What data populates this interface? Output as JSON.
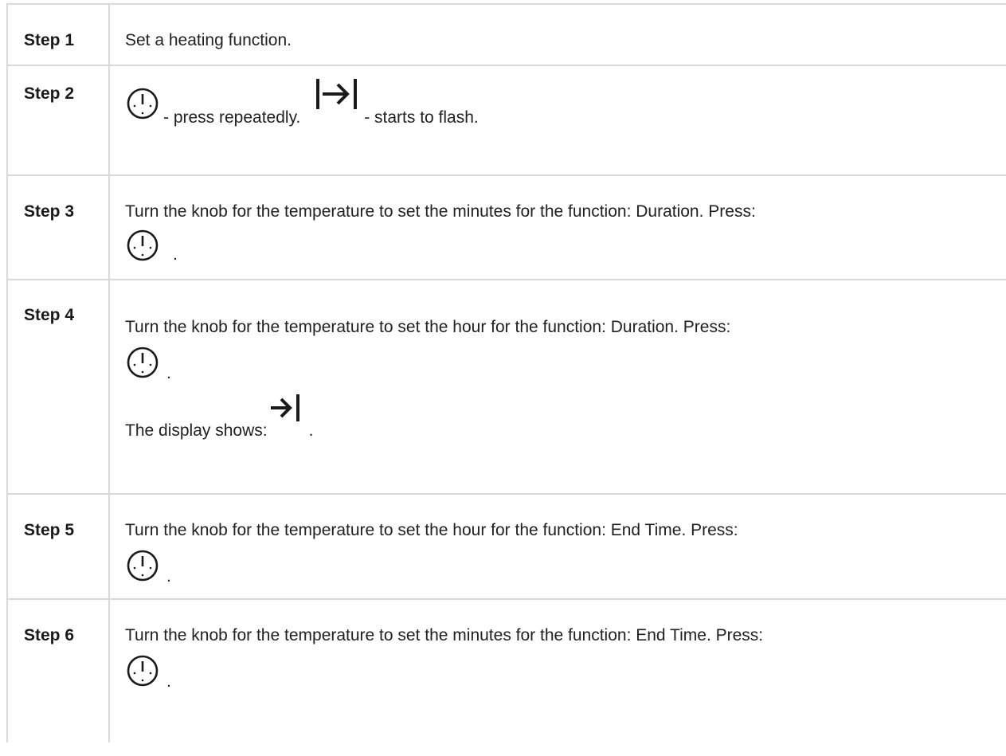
{
  "steps": [
    {
      "label": "Step 1",
      "text": "Set a heating function."
    },
    {
      "label": "Step 2",
      "text_a": "- press repeatedly.",
      "text_b": "- starts to flash.",
      "icon_a": "timer-icon",
      "icon_b": "duration-arrow-bar-icon"
    },
    {
      "label": "Step 3",
      "text": "Turn the knob for the temperature to set the minutes for the function: Duration. Press:",
      "icon": "timer-icon",
      "trail": "."
    },
    {
      "label": "Step 4",
      "text": "Turn the knob for the temperature to set the hour for the function: Duration. Press:",
      "icon": "timer-icon",
      "trail": ".",
      "display_text": "The display shows:",
      "display_icon": "end-arrow-bar-icon",
      "display_trail": "."
    },
    {
      "label": "Step 5",
      "text": "Turn the knob for the temperature to set the hour for the function: End Time. Press:",
      "icon": "timer-icon",
      "trail": "."
    },
    {
      "label": "Step 6",
      "text": "Turn the knob for the temperature to set the minutes for the function: End Time. Press:",
      "icon": "timer-icon",
      "trail": "."
    }
  ]
}
